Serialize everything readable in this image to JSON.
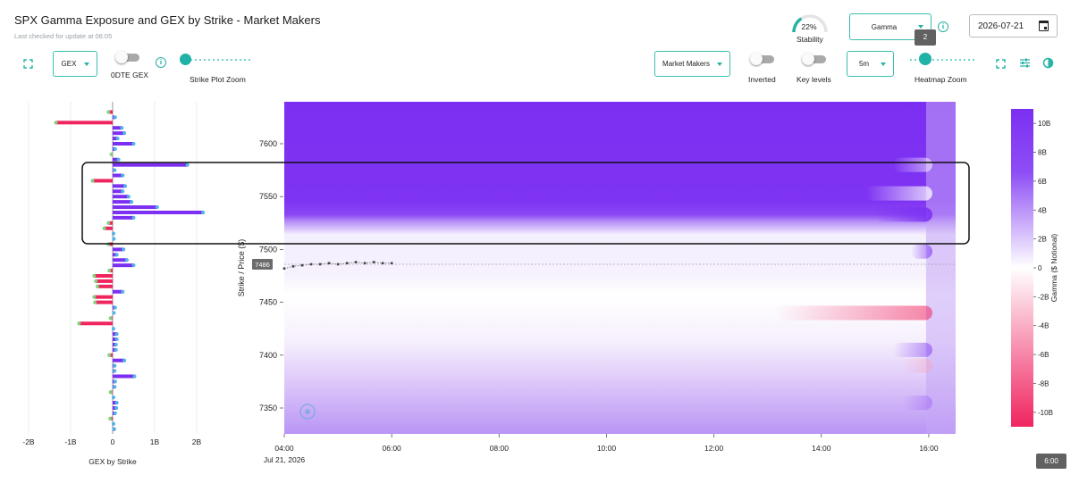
{
  "header": {
    "title": "SPX Gamma Exposure and GEX by Strike - Market Makers",
    "last_checked": "Last checked for update at 06:05"
  },
  "controls": {
    "gex_select": "GEX",
    "odte_toggle_label": "0DTE GEX",
    "strike_zoom_label": "Strike Plot Zoom",
    "stability_value": "22%",
    "stability_label": "Stability",
    "greek_select": "Gamma",
    "date": "2026-07-21",
    "zoom_tooltip": "2",
    "participant_select": "Market Makers",
    "inverted_label": "Inverted",
    "key_levels_label": "Key levels",
    "interval_select": "5m",
    "heatmap_zoom_label": "Heatmap Zoom",
    "time_tooltip": "6:00"
  },
  "icons": {
    "expand_left": "expand-icon",
    "info": "info-icon",
    "expand_right": "expand-icon",
    "settings": "tune-icon",
    "contrast": "contrast-icon",
    "calendar": "calendar-icon",
    "watermark": "logo-icon"
  },
  "colors": {
    "accent": "#27b3a5",
    "positive": "#7b2ff2",
    "negative": "#f0245f",
    "neutral": "#ffffff"
  },
  "chart_data": [
    {
      "type": "bar",
      "orientation": "horizontal",
      "xlabel": "GEX by Strike",
      "x_ticks": [
        "-2B",
        "-1B",
        "0",
        "1B",
        "2B"
      ],
      "xlim": [
        -2,
        2
      ],
      "unit": "B",
      "strikes": [
        7630,
        7625,
        7620,
        7615,
        7610,
        7605,
        7600,
        7595,
        7590,
        7585,
        7580,
        7575,
        7570,
        7565,
        7560,
        7555,
        7550,
        7545,
        7540,
        7535,
        7530,
        7525,
        7520,
        7515,
        7510,
        7505,
        7500,
        7495,
        7490,
        7485,
        7480,
        7475,
        7470,
        7465,
        7460,
        7455,
        7450,
        7445,
        7440,
        7435,
        7430,
        7425,
        7420,
        7415,
        7410,
        7405,
        7400,
        7395,
        7390,
        7385,
        7380,
        7375,
        7370,
        7365,
        7360,
        7355,
        7350,
        7345,
        7340,
        7335,
        7330
      ],
      "values": [
        -0.1,
        0.06,
        -1.35,
        0.22,
        0.28,
        0.12,
        0.5,
        0.06,
        -0.03,
        0.14,
        1.78,
        0.05,
        0.24,
        -0.48,
        0.3,
        0.24,
        0.38,
        0.45,
        1.06,
        2.15,
        0.5,
        -0.1,
        -0.2,
        0.02,
        0.03,
        -0.1,
        0.26,
        0.1,
        0.34,
        0.5,
        -0.08,
        -0.44,
        -0.4,
        -0.36,
        0.24,
        -0.44,
        -0.42,
        0.06,
        0.03,
        -0.05,
        -0.8,
        0.02,
        0.1,
        0.1,
        0.08,
        0.08,
        -0.08,
        0.28,
        0.05,
        0.05,
        0.52,
        0.06,
        0.05,
        -0.05,
        0.02,
        0.1,
        0.09,
        0.06,
        -0.06,
        0.02,
        0.04
      ]
    },
    {
      "type": "heatmap",
      "ylabel": "Strike / Price ($)",
      "y_ticks": [
        7600,
        7550,
        7500,
        7450,
        7400,
        7350
      ],
      "ylim": [
        7324,
        7641
      ],
      "x_ticks": [
        "04:00",
        "06:00",
        "08:00",
        "10:00",
        "12:00",
        "14:00",
        "16:00"
      ],
      "x_date_label": "Jul 21, 2026",
      "xlim": [
        "04:00",
        "16:30"
      ],
      "colorbar_label": "Gamma ($ Notional)",
      "colorbar_ticks": [
        "10B",
        "8B",
        "6B",
        "4B",
        "2B",
        "0",
        "-2B",
        "-4B",
        "-6B",
        "-8B",
        "-10B"
      ],
      "colorbar_range": [
        -11,
        11
      ],
      "current_price": 7486,
      "current_price_label": "7486",
      "price_series": {
        "time": [
          "04:00",
          "04:10",
          "04:20",
          "04:30",
          "04:40",
          "04:50",
          "05:00",
          "05:10",
          "05:20",
          "05:30",
          "05:40",
          "05:50",
          "06:00"
        ],
        "price": [
          7482,
          7484,
          7485,
          7486,
          7486,
          7487,
          7486,
          7487,
          7488,
          7487,
          7488,
          7487,
          7487
        ]
      },
      "highlight_range": [
        7508,
        7582
      ]
    }
  ]
}
